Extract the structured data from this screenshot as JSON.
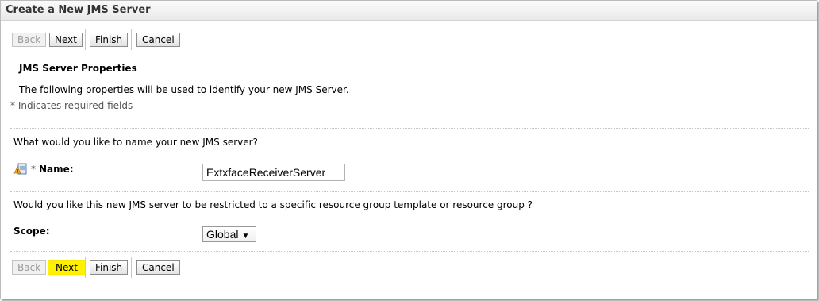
{
  "window": {
    "title": "Create a New JMS Server"
  },
  "toolbar_top": {
    "back": "Back",
    "next": "Next",
    "finish": "Finish",
    "cancel": "Cancel"
  },
  "section": {
    "heading": "JMS Server Properties",
    "description": "The following properties will be used to identify your new JMS Server.",
    "required_note": "* Indicates required fields"
  },
  "name_group": {
    "question": "What would you like to name your new JMS server?",
    "required_star": "*",
    "label": "Name:",
    "value": "ExtxfaceReceiverServer",
    "icon": "info-help-icon"
  },
  "scope_group": {
    "question": "Would you like this new JMS server to be restricted to a specific resource group template or resource group ?",
    "label": "Scope:",
    "selected": "Global"
  },
  "toolbar_bottom": {
    "back": "Back",
    "next": "Next",
    "finish": "Finish",
    "cancel": "Cancel"
  },
  "colors": {
    "highlight": "#fff200",
    "title_bg": "#ececec"
  }
}
